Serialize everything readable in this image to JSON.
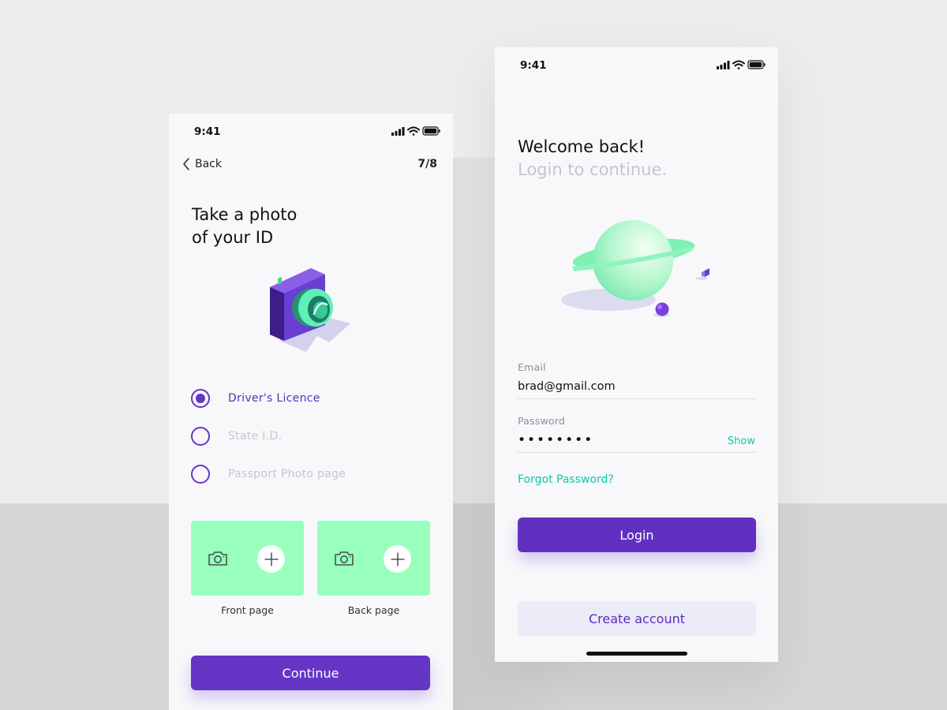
{
  "colors": {
    "accent": "#6535c6",
    "mint": "#99ffbd",
    "teal_link": "#10c7a4"
  },
  "left_screen": {
    "status_time": "9:41",
    "back_label": "Back",
    "step": "7/8",
    "title": "Take a photo\nof your ID",
    "id_options": [
      {
        "label": "Driver's Licence",
        "selected": true
      },
      {
        "label": "State I.D.",
        "selected": false
      },
      {
        "label": "Passport Photo page",
        "selected": false
      }
    ],
    "upload_cards": [
      {
        "caption": "Front page",
        "icon": "camera-icon",
        "action_icon": "plus-icon"
      },
      {
        "caption": "Back page",
        "icon": "camera-icon",
        "action_icon": "plus-icon"
      }
    ],
    "continue_label": "Continue"
  },
  "right_screen": {
    "status_time": "9:41",
    "title": "Welcome back!",
    "subtitle": "Login to continue.",
    "email_label": "Email",
    "email_value": "brad@gmail.com",
    "password_label": "Password",
    "password_value": "••••••••",
    "show_label": "Show",
    "forgot_label": "Forgot Password?",
    "login_label": "Login",
    "create_account_label": "Create account"
  }
}
